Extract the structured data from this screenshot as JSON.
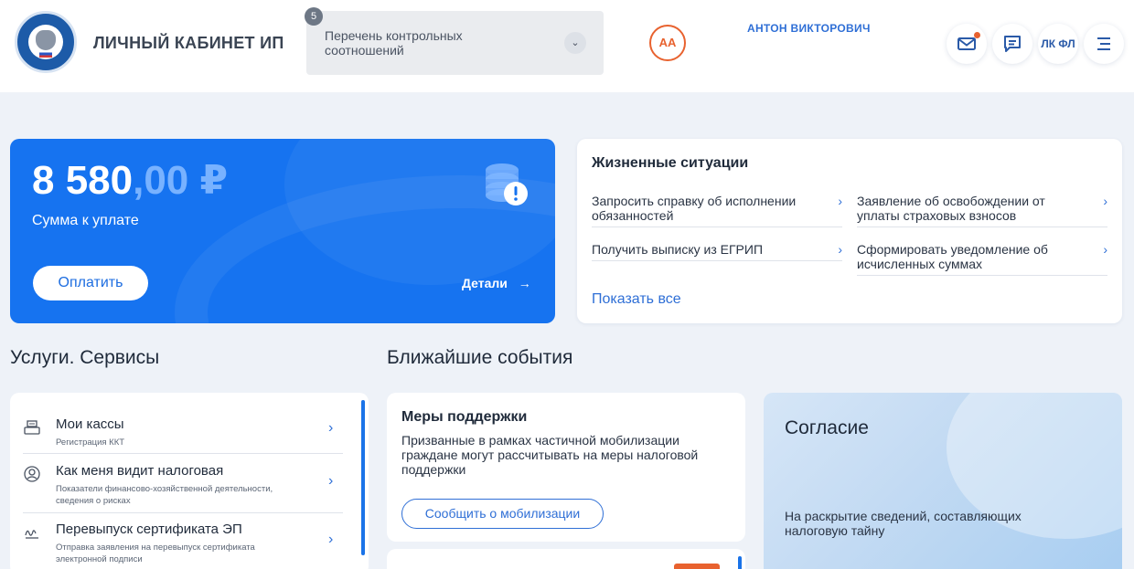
{
  "header": {
    "brand": "ЛИЧНЫЙ КАБИНЕТ ИП",
    "selector_badge": "5",
    "selector_text": "Перечень контрольных соотношений",
    "avatar_initials": "АА",
    "username": "АНТОН ВИКТОРОВИЧ",
    "lk_fl_label": "ЛК ФЛ",
    "notification_color": "#e8622f"
  },
  "payment": {
    "amount_int": "8 580",
    "amount_dec": ",00 ₽",
    "label": "Сумма к уплате",
    "pay_button": "Оплатить",
    "details_link": "Детали",
    "accent": "#1673f0"
  },
  "life": {
    "title": "Жизненные ситуации",
    "items": [
      "Запросить справку об исполнении обязанностей",
      "Заявление об освобождении от уплаты страховых взносов",
      "Получить выписку из ЕГРИП",
      "Сформировать уведомление об исчисленных суммах"
    ],
    "show_all": "Показать все"
  },
  "sections": {
    "services": "Услуги. Сервисы",
    "events": "Ближайшие события"
  },
  "services": [
    {
      "title": "Мои кассы",
      "subtitle": "Регистрация ККТ",
      "icon": "cash-register-icon"
    },
    {
      "title": "Как меня видит налоговая",
      "subtitle": "Показатели финансово-хозяйственной деятельности, сведения о рисках",
      "icon": "profile-search-icon"
    },
    {
      "title": "Перевыпуск сертификата ЭП",
      "subtitle": "Отправка заявления на перевыпуск сертификата электронной подписи",
      "icon": "signature-icon"
    }
  ],
  "event": {
    "title": "Меры поддержки",
    "text": "Призванные в рамках частичной мобилизации граждане могут рассчитывать на меры налоговой поддержки",
    "button": "Сообщить о мобилизации"
  },
  "consent": {
    "title": "Согласие",
    "text": "На раскрытие сведений, составляющих налоговую тайну"
  }
}
